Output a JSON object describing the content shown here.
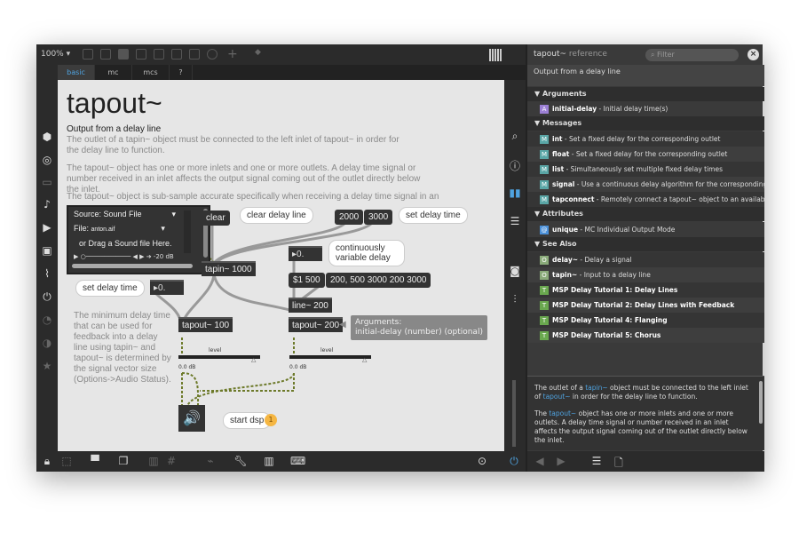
{
  "toolbar": {
    "zoom": "100%"
  },
  "tabs": [
    "basic",
    "mc",
    "mcs",
    "?"
  ],
  "help": {
    "title": "tapout~",
    "subtitle": "Output from a delay line",
    "p1": "The outlet of a tapin~ object must be connected to the left inlet of tapout~ in order for the delay line to function.",
    "p2": "The tapout~ object has one or more inlets and one or more outlets. A delay time signal or number received in an inlet affects the output signal coming out of the outlet directly below the inlet.",
    "p3": "The tapout~ object is sub-sample accurate specifically when receiving a delay time signal in an inlet.",
    "min_delay_note": "The minimum delay time that can be used for feedback into a delay line using tapin~ and tapout~ is determined by the signal vector size (Options->Audio Status)."
  },
  "player": {
    "source": "Source: Sound File",
    "file_label": "File:",
    "file": "anton.aif",
    "drag": "or Drag a Sound file Here.",
    "db": "-20 dB"
  },
  "patch": {
    "clear": "clear",
    "clear_cmt": "clear delay line",
    "m2000": "2000",
    "m3000": "3000",
    "set_delay_cmt": "set delay time",
    "tapin": "tapin~ 1000",
    "num1": "0.",
    "cont_cmt": "continuously variable delay",
    "m_1500": "$1 500",
    "m_list": "200, 500 3000 200 3000",
    "set_delay_cmt2": "set delay time",
    "num2": "0.",
    "line": "line~ 200",
    "tapout1": "tapout~ 100",
    "tapout2": "tapout~ 200",
    "arg_title": "Arguments:",
    "arg_text": "initial-delay (number) (optional)",
    "level": "level",
    "db": "0.0 dB",
    "start_dsp": "start dsp",
    "step": "1"
  },
  "reference": {
    "title": "tapout~",
    "title_suffix": "reference",
    "filter_placeholder": "Filter",
    "desc": "Output from a delay line",
    "sections": {
      "arguments": "Arguments",
      "messages": "Messages",
      "attributes": "Attributes",
      "see_also": "See Also"
    },
    "arguments": [
      {
        "name": "initial-delay",
        "desc": " - Initial delay time(s)"
      }
    ],
    "messages": [
      {
        "name": "int",
        "desc": " - Set a fixed delay for the corresponding outlet"
      },
      {
        "name": "float",
        "desc": " - Set a fixed delay for the corresponding outlet"
      },
      {
        "name": "list",
        "desc": " - Simultaneously set multiple fixed delay times"
      },
      {
        "name": "signal",
        "desc": " - Use a continuous delay algorithm for the corresponding outlet"
      },
      {
        "name": "tapconnect",
        "desc": " - Remotely connect a tapout~ object to an available tapin..."
      }
    ],
    "attributes": [
      {
        "name": "unique",
        "desc": " - MC Individual Output Mode"
      }
    ],
    "see_also": [
      {
        "name": "delay~",
        "desc": " - Delay a signal"
      },
      {
        "name": "tapin~",
        "desc": " - Input to a delay line"
      },
      {
        "name": "MSP Delay Tutorial 1: Delay Lines"
      },
      {
        "name": "MSP Delay Tutorial 2: Delay Lines with Feedback"
      },
      {
        "name": "MSP Delay Tutorial 4: Flanging"
      },
      {
        "name": "MSP Delay Tutorial 5: Chorus"
      }
    ],
    "detail": {
      "a": "The outlet of a ",
      "tapin": "tapin~",
      "b": " object must be connected to the left inlet of ",
      "tapout": "tapout~",
      "c": " in order for the delay line to function.",
      "d": "The ",
      "e": " object has one or more inlets and one or more outlets. A delay time signal or number received in an inlet affects the output signal coming out of the outlet directly below the inlet."
    }
  },
  "colors": {
    "accent": "#4fa3e0",
    "arg_badge": "#9b7fd4",
    "msg_badge": "#5aa6a6",
    "attr_badge": "#4a90d9",
    "obj_badge": "#8aab7a",
    "tut_badge": "#6aa84f",
    "step": "#f5b642"
  }
}
